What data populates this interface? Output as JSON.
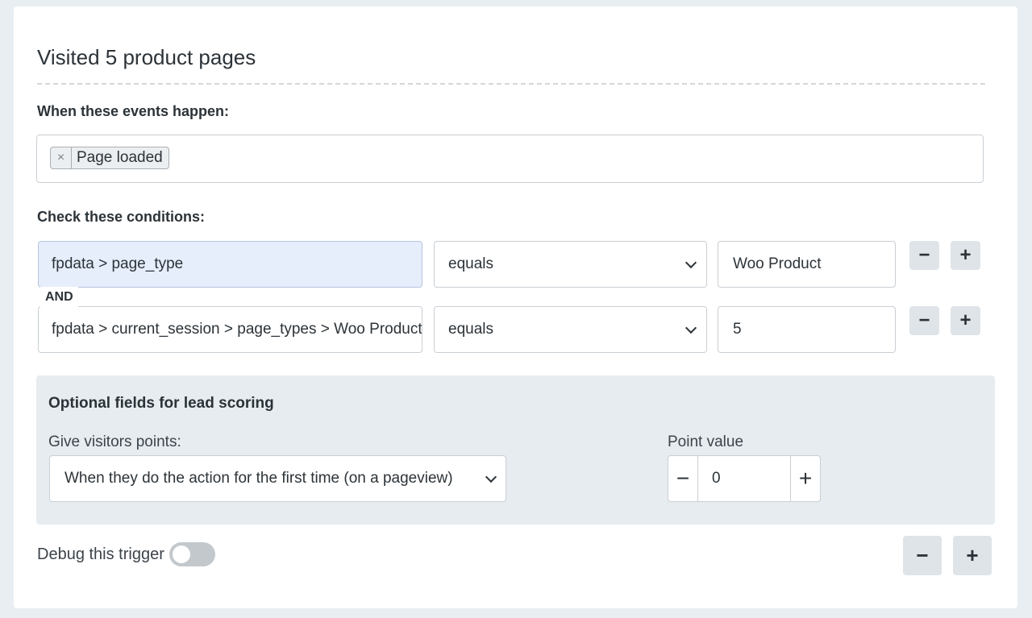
{
  "trigger": {
    "title": "Visited 5 product pages"
  },
  "events": {
    "label": "When these events happen:",
    "tags": [
      {
        "remove_symbol": "×",
        "label": "Page loaded"
      }
    ]
  },
  "conditions": {
    "label": "Check these conditions:",
    "connector": "AND",
    "rows": [
      {
        "field": "fpdata > page_type",
        "operator": "equals",
        "value": "Woo Product",
        "minus": "−",
        "plus": "+"
      },
      {
        "field": "fpdata > current_session > page_types > Woo Product",
        "operator": "equals",
        "value": "5",
        "minus": "−",
        "plus": "+"
      }
    ]
  },
  "lead_scoring": {
    "title": "Optional fields for lead scoring",
    "give_points_label": "Give visitors points:",
    "give_points_value": "When they do the action for the first time (on a pageview)",
    "point_value_label": "Point value",
    "point_value": "0",
    "minus": "−",
    "plus": "+"
  },
  "debug": {
    "label": "Debug this trigger",
    "enabled": false
  },
  "trigger_actions": {
    "minus": "−",
    "plus": "+"
  }
}
